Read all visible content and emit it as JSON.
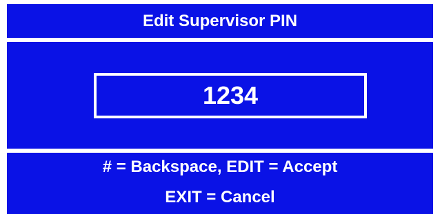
{
  "title": "Edit Supervisor PIN",
  "pin_value": "1234",
  "hints": {
    "line1": "# = Backspace, EDIT = Accept",
    "line2": "EXIT = Cancel"
  },
  "colors": {
    "panel_background": "#0a12e6",
    "text": "#ffffff",
    "page_background": "#ffffff"
  }
}
